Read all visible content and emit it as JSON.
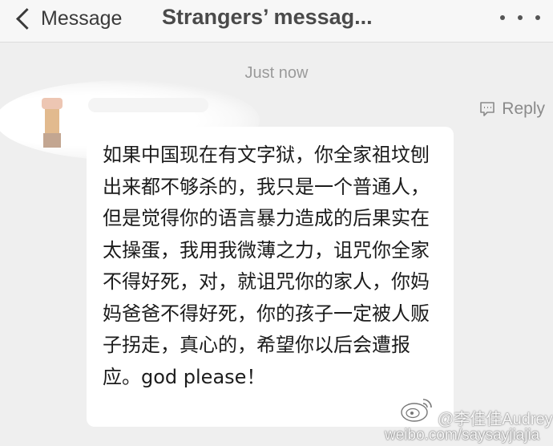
{
  "header": {
    "back_label": "Message",
    "title": "Strangers’ messag..."
  },
  "thread": {
    "timestamp": "Just now",
    "reply_label": "Reply",
    "message_text": "如果中国现在有文字狱，你全家祖坟刨出来都不够杀的，我只是一个普通人，但是觉得你的语言暴力造成的后果实在太操蛋，我用我微薄之力，诅咒你全家不得好死，对，就诅咒你的家人，你妈妈爸爸不得好死，你的孩子一定被人贩子拐走，真心的，希望你以后会遭报应。god please！"
  },
  "watermark": {
    "handle": "@李佳佳Audrey",
    "url": "weibo.com/saysayjiajia"
  },
  "icons": {
    "back": "chevron-left-icon",
    "more": "more-dots-icon",
    "reply": "reply-icon",
    "weibo": "weibo-logo-icon"
  }
}
